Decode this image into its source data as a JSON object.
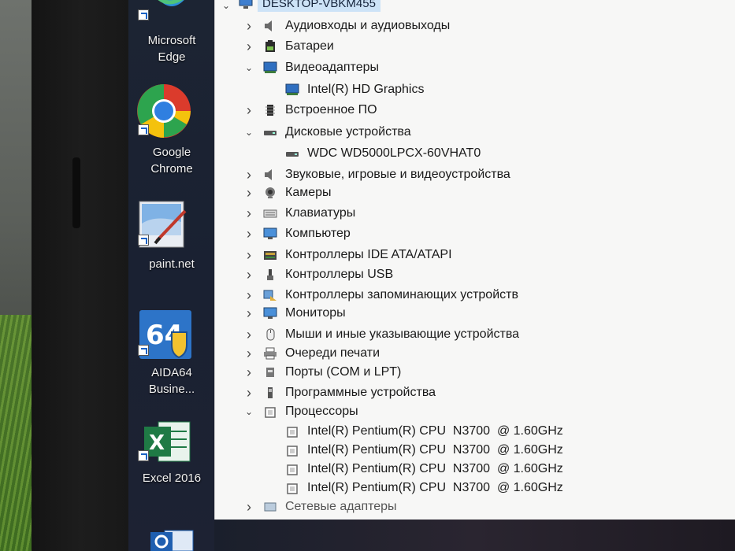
{
  "window": {
    "root_label": "DESKTOP-VBKM455"
  },
  "desktop_icons": [
    {
      "label_line1": "Microsoft",
      "label_line2": "Edge"
    },
    {
      "label_line1": "Google",
      "label_line2": "Chrome"
    },
    {
      "label_line1": "paint.net",
      "label_line2": ""
    },
    {
      "label_line1": "AIDA64",
      "label_line2": "Busine..."
    },
    {
      "label_line1": "Excel 2016",
      "label_line2": ""
    }
  ],
  "tree": [
    {
      "label": "Аудиовходы и аудиовыходы",
      "state": "collapsed",
      "level": 1,
      "icon": "speaker-icon"
    },
    {
      "label": "Батареи",
      "state": "collapsed",
      "level": 1,
      "icon": "battery-icon"
    },
    {
      "label": "Видеоадаптеры",
      "state": "expanded",
      "level": 1,
      "icon": "display-adapter-icon"
    },
    {
      "label": "Intel(R) HD Graphics",
      "state": "leaf",
      "level": 2,
      "icon": "display-adapter-icon"
    },
    {
      "label": "Встроенное ПО",
      "state": "collapsed",
      "level": 1,
      "icon": "firmware-icon"
    },
    {
      "label": "Дисковые устройства",
      "state": "expanded",
      "level": 1,
      "icon": "disk-drive-icon"
    },
    {
      "label": "WDC WD5000LPCX-60VHAT0",
      "state": "leaf",
      "level": 2,
      "icon": "disk-drive-icon"
    },
    {
      "label": "Звуковые, игровые и видеоустройства",
      "state": "collapsed",
      "level": 1,
      "icon": "speaker-icon"
    },
    {
      "label": "Камеры",
      "state": "collapsed",
      "level": 1,
      "icon": "camera-icon"
    },
    {
      "label": "Клавиатуры",
      "state": "collapsed",
      "level": 1,
      "icon": "keyboard-icon"
    },
    {
      "label": "Компьютер",
      "state": "collapsed",
      "level": 1,
      "icon": "monitor-icon"
    },
    {
      "label": "Контроллеры IDE ATA/ATAPI",
      "state": "collapsed",
      "level": 1,
      "icon": "ide-controller-icon"
    },
    {
      "label": "Контроллеры USB",
      "state": "collapsed",
      "level": 1,
      "icon": "usb-icon"
    },
    {
      "label": "Контроллеры запоминающих устройств",
      "state": "collapsed",
      "level": 1,
      "icon": "storage-controller-icon"
    },
    {
      "label": "Мониторы",
      "state": "collapsed",
      "level": 1,
      "icon": "monitor-icon"
    },
    {
      "label": "Мыши и иные указывающие устройства",
      "state": "collapsed",
      "level": 1,
      "icon": "mouse-icon"
    },
    {
      "label": "Очереди печати",
      "state": "collapsed",
      "level": 1,
      "icon": "printer-icon"
    },
    {
      "label": "Порты (COM и LPT)",
      "state": "collapsed",
      "level": 1,
      "icon": "port-icon"
    },
    {
      "label": "Программные устройства",
      "state": "collapsed",
      "level": 1,
      "icon": "software-device-icon"
    },
    {
      "label": "Процессоры",
      "state": "expanded",
      "level": 1,
      "icon": "processor-icon"
    },
    {
      "label": "Intel(R) Pentium(R) CPU  N3700  @ 1.60GHz",
      "state": "leaf",
      "level": 2,
      "icon": "processor-icon"
    },
    {
      "label": "Intel(R) Pentium(R) CPU  N3700  @ 1.60GHz",
      "state": "leaf",
      "level": 2,
      "icon": "processor-icon"
    },
    {
      "label": "Intel(R) Pentium(R) CPU  N3700  @ 1.60GHz",
      "state": "leaf",
      "level": 2,
      "icon": "processor-icon"
    },
    {
      "label": "Intel(R) Pentium(R) CPU  N3700  @ 1.60GHz",
      "state": "leaf",
      "level": 2,
      "icon": "processor-icon"
    },
    {
      "label": "Сетевые адаптеры",
      "state": "collapsed",
      "level": 1,
      "icon": "network-adapter-icon"
    }
  ],
  "colors": {
    "selection": "#cde3f7",
    "window_bg": "#f7f7f6",
    "desktop_bg": "#1c2433"
  }
}
